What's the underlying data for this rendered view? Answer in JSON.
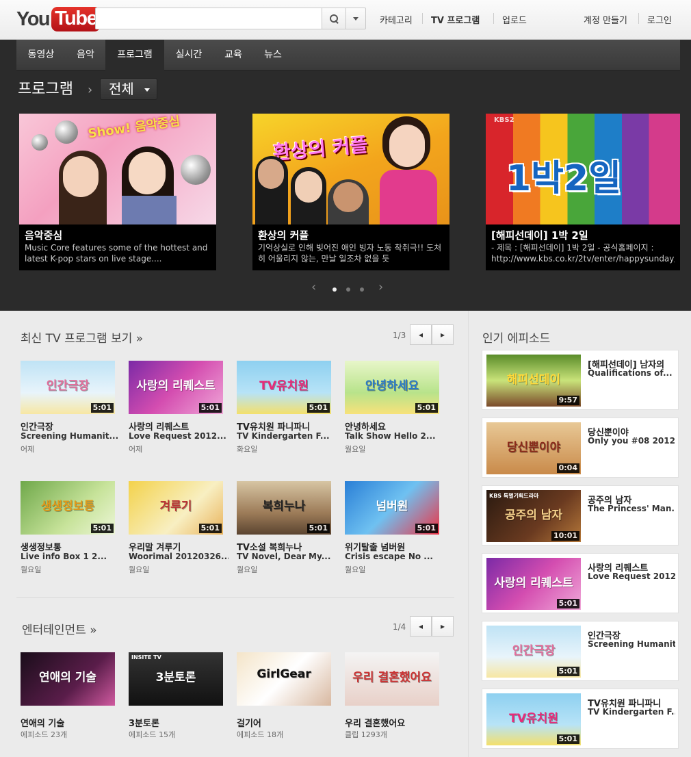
{
  "header": {
    "logo_you": "You",
    "logo_tube": "Tube",
    "search": {
      "value": "",
      "placeholder": ""
    },
    "nav": [
      "카테고리",
      "TV 프로그램",
      "업로드"
    ],
    "account": [
      "계정 만들기",
      "로그인"
    ]
  },
  "tabs": [
    "동영상",
    "음악",
    "프로그램",
    "실시간",
    "교육",
    "뉴스"
  ],
  "active_tab": "프로그램",
  "breadcrumb": {
    "section": "프로그램",
    "arrow": "›",
    "filter": "전체"
  },
  "featured": [
    {
      "title": "음악중심",
      "desc": "Music Core features some of the hottest and latest K-pop stars on live stage....",
      "art_text": "Show! 음악중심"
    },
    {
      "title": "환상의 커플",
      "desc": "기억상실로 인해 빚어진 애인 빙자 노동 착취극!! 도처히 어울리지 않는, 만날 일조차 없을 듯",
      "art_text": "환상의 커플"
    },
    {
      "title": "[해피선데이] 1박 2일",
      "desc": "- 제목 : [해피선데이] 1박 2일 - 공식홈페이지 : http://www.kbs.co.kr/2tv/enter/happysunday/",
      "art_text": "1박2일",
      "art_badge": "KBS2"
    }
  ],
  "carousel": {
    "prev": "‹",
    "next": "›",
    "pages": 3,
    "current": 1
  },
  "latest": {
    "heading": "최신 TV 프로그램 보기 »",
    "page": "1/3",
    "prev": "◂",
    "next": "▸",
    "videos": [
      {
        "title": "인간극장",
        "subtitle": "Screening Humanit...",
        "meta": "어제",
        "duration": "5:01",
        "art": "인간극장"
      },
      {
        "title": "사랑의 리퀘스트",
        "subtitle": "Love Request 2012...",
        "meta": "어제",
        "duration": "5:01",
        "art": "사랑의 리퀘스트"
      },
      {
        "title": "TV유치원 파니파니",
        "subtitle": "TV Kindergarten F...",
        "meta": "화요일",
        "duration": "5:01",
        "art": "TV유치원"
      },
      {
        "title": "안녕하세요",
        "subtitle": "Talk Show Hello 2...",
        "meta": "월요일",
        "duration": "5:01",
        "art": "안녕하세요"
      },
      {
        "title": "생생정보통",
        "subtitle": "Live info Box 1 2...",
        "meta": "월요일",
        "duration": "5:01",
        "art": "생생정보통"
      },
      {
        "title": "우리말 겨루기",
        "subtitle": "Woorimal 20120326...",
        "meta": "월요일",
        "duration": "5:01",
        "art": "겨루기"
      },
      {
        "title": "TV소설 복희누나",
        "subtitle": "TV Novel, Dear My...",
        "meta": "월요일",
        "duration": "5:01",
        "art": "복희누나"
      },
      {
        "title": "위기탈출 넘버원",
        "subtitle": "Crisis escape No ...",
        "meta": "월요일",
        "duration": "5:01",
        "art": "넘버원"
      }
    ]
  },
  "entertainment": {
    "heading": "엔터테인먼트 »",
    "page": "1/4",
    "prev": "◂",
    "next": "▸",
    "videos": [
      {
        "title": "연애의 기술",
        "meta": "에피소드 23개",
        "art": "연애의 기술"
      },
      {
        "title": "3분토론",
        "meta": "에피소드 15개",
        "art": "3분토론",
        "badge": "INSITE TV"
      },
      {
        "title": "걸기어",
        "meta": "에피소드 18개",
        "art": "GirlGear"
      },
      {
        "title": "우리 결혼했어요",
        "meta": "클립 1293개",
        "art": "우리 결혼했어요"
      }
    ]
  },
  "popular": {
    "heading": "인기 에피소드",
    "items": [
      {
        "title": "[해피선데이] 남자의",
        "subtitle": "Qualifications of...",
        "duration": "9:57",
        "art": "해피선데이"
      },
      {
        "title": "당신뿐이야",
        "subtitle": "Only you #08 2012...",
        "duration": "0:04",
        "art": "당신뿐이야"
      },
      {
        "title": "공주의 남자",
        "subtitle": "The Princess' Man...",
        "duration": "10:01",
        "art": "공주의 남자",
        "badge": "KBS 특별기획드라마"
      },
      {
        "title": "사랑의 리퀘스트",
        "subtitle": "Love Request 2012...",
        "duration": "5:01",
        "art": "사랑의 리퀘스트"
      },
      {
        "title": "인간극장",
        "subtitle": "Screening Humanit...",
        "duration": "5:01",
        "art": "인간극장"
      },
      {
        "title": "TV유치원 파니파니",
        "subtitle": "TV Kindergarten F...",
        "duration": "5:01",
        "art": "TV유치원"
      }
    ]
  },
  "colors": {
    "brand_red": "#cc181e",
    "dark_bg": "#2b2b2b",
    "page_bg": "#ebebeb"
  }
}
